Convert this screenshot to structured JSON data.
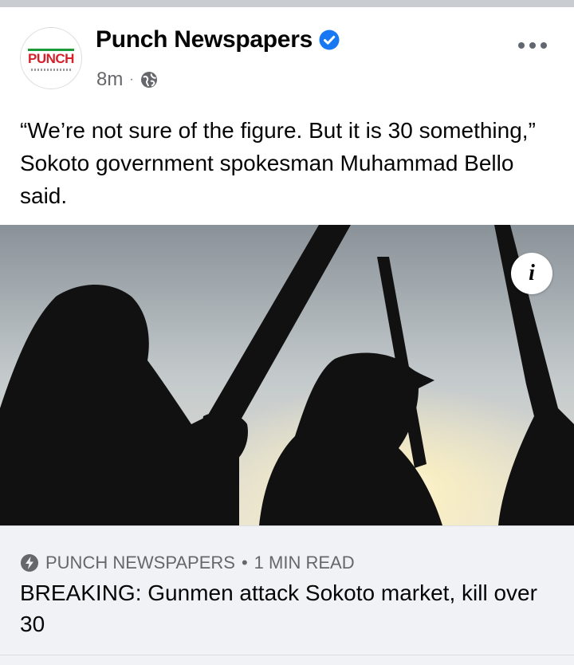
{
  "post": {
    "page_name": "Punch Newspapers",
    "timestamp": "8m",
    "separator": "·",
    "logo_text": "PUNCH",
    "caption": "“We’re not sure of the figure. But it is 30 something,” Sokoto government spokesman Muhammad Bello said.",
    "icons": {
      "verified": "verified-badge-icon",
      "audience": "globe-icon",
      "more": "more-options-icon",
      "info": "info-icon",
      "instant_article": "lightning-bolt-icon"
    }
  },
  "photo": {
    "info_label": "i"
  },
  "link": {
    "source": "PUNCH NEWSPAPERS",
    "dot": "•",
    "read_time": "1 MIN READ",
    "headline": "BREAKING: Gunmen attack Sokoto market, kill over 30"
  },
  "colors": {
    "verified": "#1877f2",
    "secondary_text": "#65676b",
    "link_background": "#f0f2f5",
    "logo_red": "#d6202a",
    "logo_green": "#1a9a3a"
  }
}
